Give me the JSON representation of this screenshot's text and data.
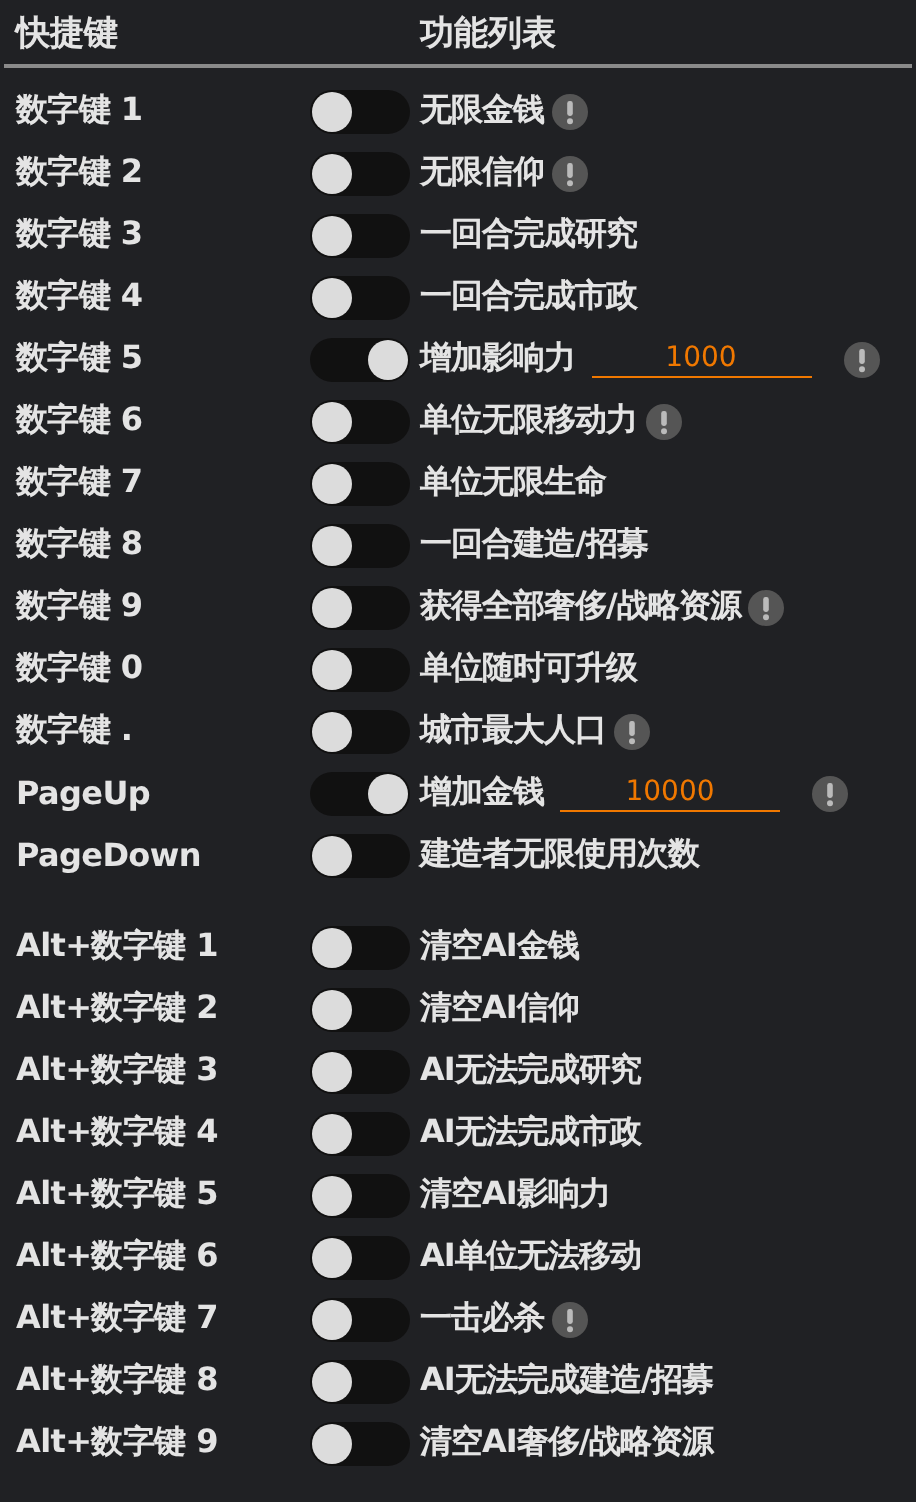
{
  "header": {
    "key_column": "快捷键",
    "function_column": "功能列表"
  },
  "groups": [
    {
      "rows": [
        {
          "key": "数字键 1",
          "label": "无限金钱",
          "on": false,
          "info": true,
          "kind": "plain"
        },
        {
          "key": "数字键 2",
          "label": "无限信仰",
          "on": false,
          "info": true,
          "kind": "plain"
        },
        {
          "key": "数字键 3",
          "label": "一回合完成研究",
          "on": false,
          "info": false,
          "kind": "plain"
        },
        {
          "key": "数字键 4",
          "label": "一回合完成市政",
          "on": false,
          "info": false,
          "kind": "plain"
        },
        {
          "key": "数字键 5",
          "label": "增加影响力",
          "on": true,
          "info": true,
          "kind": "input",
          "value": "1000"
        },
        {
          "key": "数字键 6",
          "label": "单位无限移动力",
          "on": false,
          "info": true,
          "kind": "plain"
        },
        {
          "key": "数字键 7",
          "label": "单位无限生命",
          "on": false,
          "info": false,
          "kind": "plain"
        },
        {
          "key": "数字键 8",
          "label": "一回合建造/招募",
          "on": false,
          "info": false,
          "kind": "plain"
        },
        {
          "key": "数字键 9",
          "label": "获得全部奢侈/战略资源",
          "on": false,
          "info": true,
          "kind": "plain"
        },
        {
          "key": "数字键 0",
          "label": "单位随时可升级",
          "on": false,
          "info": false,
          "kind": "plain"
        },
        {
          "key": "数字键 .",
          "label": "城市最大人口",
          "on": false,
          "info": true,
          "kind": "plain"
        },
        {
          "key": "PageUp",
          "label": "增加金钱",
          "on": true,
          "info": true,
          "kind": "input",
          "value": "10000"
        },
        {
          "key": "PageDown",
          "label": "建造者无限使用次数",
          "on": false,
          "info": false,
          "kind": "plain"
        }
      ]
    },
    {
      "rows": [
        {
          "key": "Alt+数字键 1",
          "label": "清空AI金钱",
          "on": false,
          "info": false,
          "kind": "plain"
        },
        {
          "key": "Alt+数字键 2",
          "label": "清空AI信仰",
          "on": false,
          "info": false,
          "kind": "plain"
        },
        {
          "key": "Alt+数字键 3",
          "label": "AI无法完成研究",
          "on": false,
          "info": false,
          "kind": "plain"
        },
        {
          "key": "Alt+数字键 4",
          "label": "AI无法完成市政",
          "on": false,
          "info": false,
          "kind": "plain"
        },
        {
          "key": "Alt+数字键 5",
          "label": "清空AI影响力",
          "on": false,
          "info": false,
          "kind": "plain"
        },
        {
          "key": "Alt+数字键 6",
          "label": "AI单位无法移动",
          "on": false,
          "info": false,
          "kind": "plain"
        },
        {
          "key": "Alt+数字键 7",
          "label": "一击必杀",
          "on": false,
          "info": true,
          "kind": "plain"
        },
        {
          "key": "Alt+数字键 8",
          "label": "AI无法完成建造/招募",
          "on": false,
          "info": false,
          "kind": "plain"
        },
        {
          "key": "Alt+数字键 9",
          "label": "清空AI奢侈/战略资源",
          "on": false,
          "info": false,
          "kind": "plain"
        }
      ]
    }
  ]
}
